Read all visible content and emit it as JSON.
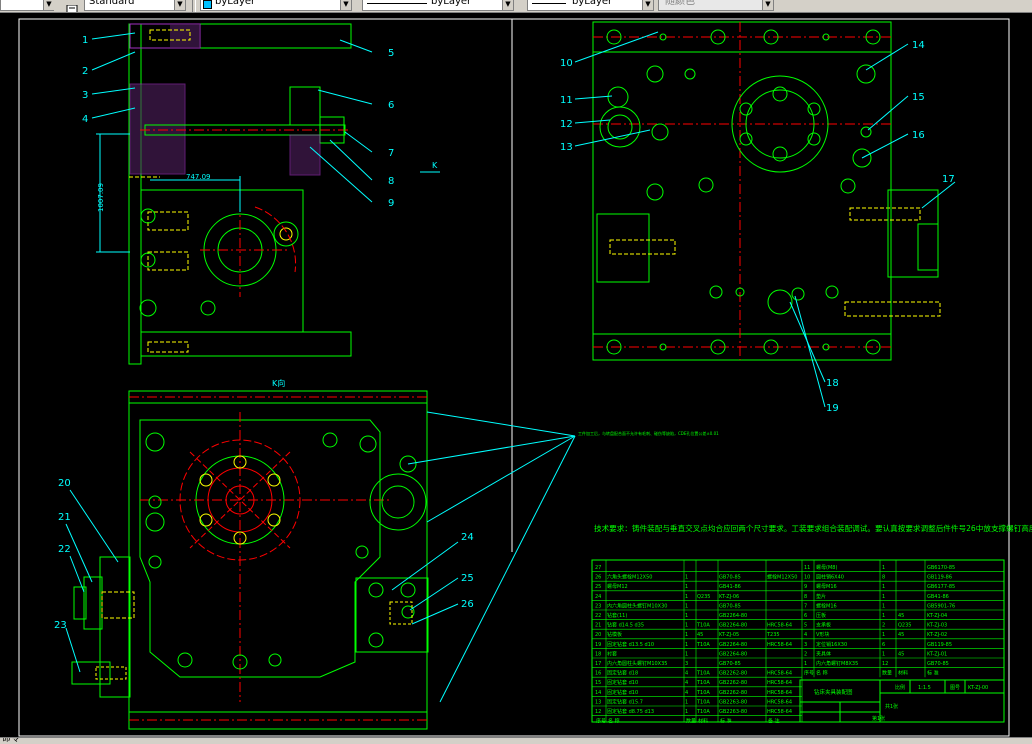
{
  "toolbar": {
    "text_style": "Standard",
    "layer": "byLayer",
    "linetype": "byLayer",
    "lineweight": "byLayer",
    "plot_style": "随颜色"
  },
  "status": {
    "command": "命令"
  },
  "colors": {
    "background": "#000000",
    "frame": "#00ff00",
    "leader": "#00ffff",
    "center": "#ff0000",
    "hidden": "#ffff00",
    "hatch": "#a030c0",
    "text_green": "#00ff00",
    "dim": "#00ffff"
  },
  "drawing": {
    "callouts_left": [
      "1",
      "2",
      "3",
      "4",
      "20",
      "21",
      "22",
      "23"
    ],
    "callouts_right": [
      "5",
      "6",
      "7",
      "8",
      "9",
      "24",
      "25",
      "26"
    ],
    "callouts_top_view_left": [
      "10",
      "11",
      "12",
      "13"
    ],
    "callouts_top_view_right": [
      "14",
      "15",
      "16",
      "17",
      "18",
      "19"
    ],
    "dim_horizontal": "747.09",
    "dim_vertical": "1007.09",
    "section_k_label": "K",
    "view_k_label": "K向",
    "note_tiny": "工件加工后，与转盘配合面不允许有毛刺、碰伤等缺陷，CDE孔位置公差±0.01",
    "tech_requirements": "技术要求：铸件装配与垂直交叉点均合应回两个尺寸要求。工装要求组合装配调试。要认真按要求调整后件件号26中放支撑螺钉高度，并且用螺母锁紧。"
  },
  "bom": {
    "header_left": [
      "序号",
      "名 称",
      "数量",
      "材料",
      "标 准",
      "备 注"
    ],
    "header_right": [
      "序号",
      "名 称",
      "数量",
      "材料",
      "标 准"
    ],
    "rows_left": [
      {
        "no": "27",
        "name": "",
        "qty": "",
        "mat": "",
        "std": "",
        "note": ""
      },
      {
        "no": "26",
        "name": "六角头螺栓M12X50",
        "qty": "1",
        "mat": "",
        "std": "GB70-85",
        "note": "螺栓M12X50"
      },
      {
        "no": "25",
        "name": "螺母M12",
        "qty": "1",
        "mat": "",
        "std": "GB41-86",
        "note": ""
      },
      {
        "no": "24",
        "name": "",
        "qty": "1",
        "mat": "Q235",
        "std": "KT-ZJ-06",
        "note": ""
      },
      {
        "no": "23",
        "name": "内六角圆柱头螺钉M10X30",
        "qty": "1",
        "mat": "",
        "std": "GB70-85",
        "note": ""
      },
      {
        "no": "22",
        "name": "钻套(11)",
        "qty": "1",
        "mat": "",
        "std": "GB2264-80",
        "note": ""
      },
      {
        "no": "21",
        "name": "钻套 d14.5 d35",
        "qty": "1",
        "mat": "T10A",
        "std": "GB2264-80",
        "note": "HRC58-64"
      },
      {
        "no": "20",
        "name": "钻模板",
        "qty": "1",
        "mat": "45",
        "std": "KT-ZJ-05",
        "note": "T235"
      },
      {
        "no": "19",
        "name": "固定钻套 d13.5 d10",
        "qty": "1",
        "mat": "T10A",
        "std": "GB2264-80",
        "note": "HRC58-64"
      },
      {
        "no": "18",
        "name": "衬套",
        "qty": "1",
        "mat": "",
        "std": "GB2264-80",
        "note": ""
      },
      {
        "no": "17",
        "name": "内六角圆柱头螺钉M10X35",
        "qty": "3",
        "mat": "",
        "std": "GB70-85",
        "note": ""
      },
      {
        "no": "16",
        "name": "固定钻套 d18",
        "qty": "4",
        "mat": "T10A",
        "std": "GB2262-80",
        "note": "HRC58-64"
      },
      {
        "no": "15",
        "name": "固定钻套 d10",
        "qty": "4",
        "mat": "T10A",
        "std": "GB2262-80",
        "note": "HRC58-64"
      },
      {
        "no": "14",
        "name": "固定钻套 d10",
        "qty": "4",
        "mat": "T10A",
        "std": "GB2262-80",
        "note": "HRC58-64"
      },
      {
        "no": "13",
        "name": "固定钻套 d15.7",
        "qty": "1",
        "mat": "T10A",
        "std": "GB2263-80",
        "note": "HRC58-64"
      },
      {
        "no": "12",
        "name": "固定钻套 d8.75 d13",
        "qty": "1",
        "mat": "T10A",
        "std": "GB2263-80",
        "note": "HRC58-64"
      }
    ],
    "rows_right": [
      {
        "no": "11",
        "name": "螺母(M8)",
        "qty": "1",
        "mat": "",
        "std": "GB6170-85"
      },
      {
        "no": "10",
        "name": "圆柱销6X40",
        "qty": "8",
        "mat": "",
        "std": "GB119-86"
      },
      {
        "no": "9",
        "name": "螺母M16",
        "qty": "1",
        "mat": "",
        "std": "GB6177-85"
      },
      {
        "no": "8",
        "name": "垫片",
        "qty": "1",
        "mat": "",
        "std": "GB41-86"
      },
      {
        "no": "7",
        "name": "螺栓M16",
        "qty": "1",
        "mat": "",
        "std": "GB5901-76"
      },
      {
        "no": "6",
        "name": "压板",
        "qty": "1",
        "mat": "45",
        "std": "KT-ZJ-04"
      },
      {
        "no": "5",
        "name": "支承板",
        "qty": "2",
        "mat": "Q235",
        "std": "KT-ZJ-03"
      },
      {
        "no": "4",
        "name": "V形块",
        "qty": "1",
        "mat": "45",
        "std": "KT-ZJ-02"
      },
      {
        "no": "3",
        "name": "定位销16X30",
        "qty": "6",
        "mat": "",
        "std": "GB119-85"
      },
      {
        "no": "2",
        "name": "夹具体",
        "qty": "1",
        "mat": "45",
        "std": "KT-ZJ-01"
      },
      {
        "no": "1",
        "name": "内六角螺钉M8X35",
        "qty": "12",
        "mat": "",
        "std": "GB70-85"
      }
    ],
    "title_block": {
      "drawing_name": "钻床夹具装配图",
      "scale_label": "比例",
      "scale": "1:1.5",
      "drawing_no_label": "图号",
      "drawing_no": "KT-ZJ-00",
      "sheet": "第1张",
      "weight": "共1张"
    }
  }
}
